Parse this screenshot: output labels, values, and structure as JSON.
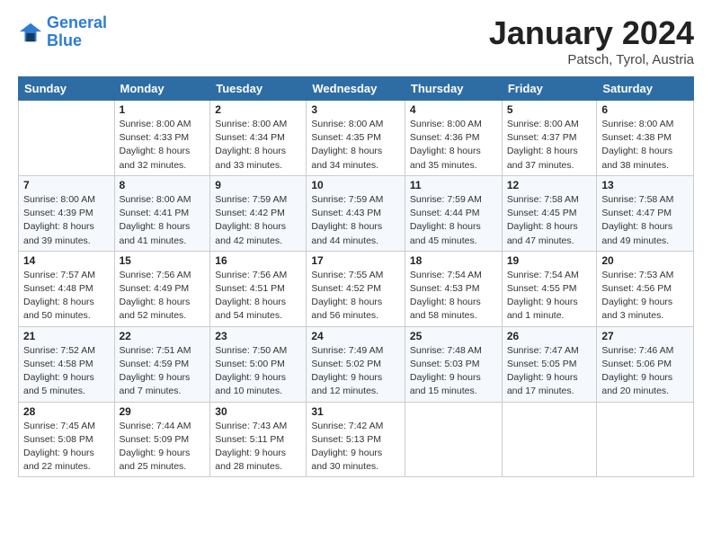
{
  "header": {
    "logo_line1": "General",
    "logo_line2": "Blue",
    "month": "January 2024",
    "location": "Patsch, Tyrol, Austria"
  },
  "columns": [
    "Sunday",
    "Monday",
    "Tuesday",
    "Wednesday",
    "Thursday",
    "Friday",
    "Saturday"
  ],
  "weeks": [
    [
      {
        "day": "",
        "info": ""
      },
      {
        "day": "1",
        "info": "Sunrise: 8:00 AM\nSunset: 4:33 PM\nDaylight: 8 hours\nand 32 minutes."
      },
      {
        "day": "2",
        "info": "Sunrise: 8:00 AM\nSunset: 4:34 PM\nDaylight: 8 hours\nand 33 minutes."
      },
      {
        "day": "3",
        "info": "Sunrise: 8:00 AM\nSunset: 4:35 PM\nDaylight: 8 hours\nand 34 minutes."
      },
      {
        "day": "4",
        "info": "Sunrise: 8:00 AM\nSunset: 4:36 PM\nDaylight: 8 hours\nand 35 minutes."
      },
      {
        "day": "5",
        "info": "Sunrise: 8:00 AM\nSunset: 4:37 PM\nDaylight: 8 hours\nand 37 minutes."
      },
      {
        "day": "6",
        "info": "Sunrise: 8:00 AM\nSunset: 4:38 PM\nDaylight: 8 hours\nand 38 minutes."
      }
    ],
    [
      {
        "day": "7",
        "info": "Sunrise: 8:00 AM\nSunset: 4:39 PM\nDaylight: 8 hours\nand 39 minutes."
      },
      {
        "day": "8",
        "info": "Sunrise: 8:00 AM\nSunset: 4:41 PM\nDaylight: 8 hours\nand 41 minutes."
      },
      {
        "day": "9",
        "info": "Sunrise: 7:59 AM\nSunset: 4:42 PM\nDaylight: 8 hours\nand 42 minutes."
      },
      {
        "day": "10",
        "info": "Sunrise: 7:59 AM\nSunset: 4:43 PM\nDaylight: 8 hours\nand 44 minutes."
      },
      {
        "day": "11",
        "info": "Sunrise: 7:59 AM\nSunset: 4:44 PM\nDaylight: 8 hours\nand 45 minutes."
      },
      {
        "day": "12",
        "info": "Sunrise: 7:58 AM\nSunset: 4:45 PM\nDaylight: 8 hours\nand 47 minutes."
      },
      {
        "day": "13",
        "info": "Sunrise: 7:58 AM\nSunset: 4:47 PM\nDaylight: 8 hours\nand 49 minutes."
      }
    ],
    [
      {
        "day": "14",
        "info": "Sunrise: 7:57 AM\nSunset: 4:48 PM\nDaylight: 8 hours\nand 50 minutes."
      },
      {
        "day": "15",
        "info": "Sunrise: 7:56 AM\nSunset: 4:49 PM\nDaylight: 8 hours\nand 52 minutes."
      },
      {
        "day": "16",
        "info": "Sunrise: 7:56 AM\nSunset: 4:51 PM\nDaylight: 8 hours\nand 54 minutes."
      },
      {
        "day": "17",
        "info": "Sunrise: 7:55 AM\nSunset: 4:52 PM\nDaylight: 8 hours\nand 56 minutes."
      },
      {
        "day": "18",
        "info": "Sunrise: 7:54 AM\nSunset: 4:53 PM\nDaylight: 8 hours\nand 58 minutes."
      },
      {
        "day": "19",
        "info": "Sunrise: 7:54 AM\nSunset: 4:55 PM\nDaylight: 9 hours\nand 1 minute."
      },
      {
        "day": "20",
        "info": "Sunrise: 7:53 AM\nSunset: 4:56 PM\nDaylight: 9 hours\nand 3 minutes."
      }
    ],
    [
      {
        "day": "21",
        "info": "Sunrise: 7:52 AM\nSunset: 4:58 PM\nDaylight: 9 hours\nand 5 minutes."
      },
      {
        "day": "22",
        "info": "Sunrise: 7:51 AM\nSunset: 4:59 PM\nDaylight: 9 hours\nand 7 minutes."
      },
      {
        "day": "23",
        "info": "Sunrise: 7:50 AM\nSunset: 5:00 PM\nDaylight: 9 hours\nand 10 minutes."
      },
      {
        "day": "24",
        "info": "Sunrise: 7:49 AM\nSunset: 5:02 PM\nDaylight: 9 hours\nand 12 minutes."
      },
      {
        "day": "25",
        "info": "Sunrise: 7:48 AM\nSunset: 5:03 PM\nDaylight: 9 hours\nand 15 minutes."
      },
      {
        "day": "26",
        "info": "Sunrise: 7:47 AM\nSunset: 5:05 PM\nDaylight: 9 hours\nand 17 minutes."
      },
      {
        "day": "27",
        "info": "Sunrise: 7:46 AM\nSunset: 5:06 PM\nDaylight: 9 hours\nand 20 minutes."
      }
    ],
    [
      {
        "day": "28",
        "info": "Sunrise: 7:45 AM\nSunset: 5:08 PM\nDaylight: 9 hours\nand 22 minutes."
      },
      {
        "day": "29",
        "info": "Sunrise: 7:44 AM\nSunset: 5:09 PM\nDaylight: 9 hours\nand 25 minutes."
      },
      {
        "day": "30",
        "info": "Sunrise: 7:43 AM\nSunset: 5:11 PM\nDaylight: 9 hours\nand 28 minutes."
      },
      {
        "day": "31",
        "info": "Sunrise: 7:42 AM\nSunset: 5:13 PM\nDaylight: 9 hours\nand 30 minutes."
      },
      {
        "day": "",
        "info": ""
      },
      {
        "day": "",
        "info": ""
      },
      {
        "day": "",
        "info": ""
      }
    ]
  ]
}
